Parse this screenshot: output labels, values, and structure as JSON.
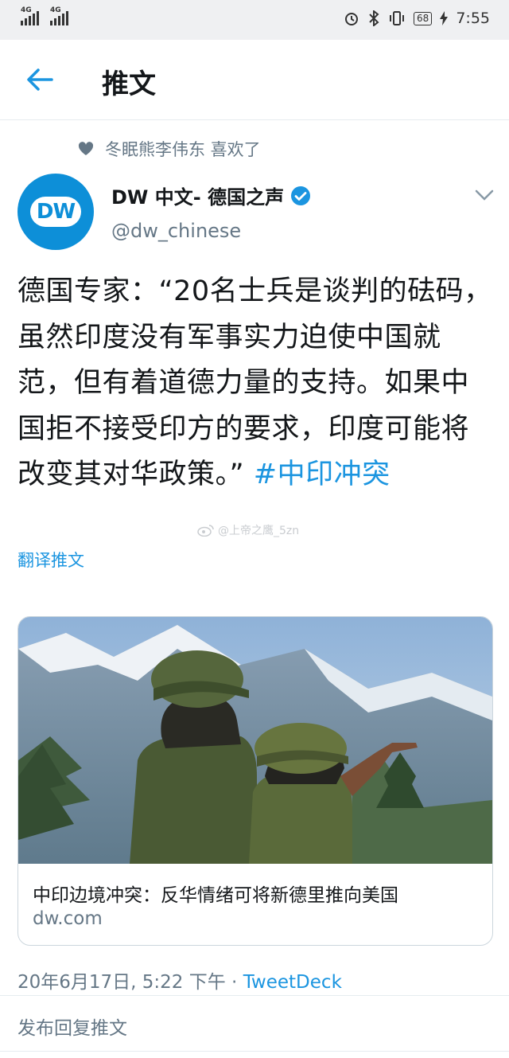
{
  "status_bar": {
    "signal1": "4G",
    "signal2": "4G",
    "battery": "68",
    "time": "7:55",
    "icons": [
      "alarm-icon",
      "bluetooth-icon",
      "vibrate-icon",
      "battery-icon",
      "charging-icon"
    ]
  },
  "header": {
    "back_icon": "arrow-left-icon",
    "title": "推文"
  },
  "liked_by": {
    "icon": "heart-icon",
    "text": "冬眠熊李伟东 喜欢了"
  },
  "tweet": {
    "avatar_text": "DW",
    "display_name": "DW 中文- 德国之声",
    "verified": true,
    "handle": "@dw_chinese",
    "text": "德国专家：“20名士兵是谈判的砝码，虽然印度没有军事实力迫使中国就范，但有着道德力量的支持。如果中国拒不接受印方的要求，印度可能将改变其对华政策。” ",
    "hashtag": "#中印冲突",
    "watermark": "@上帝之鹰_5zn",
    "translate_label": "翻译推文",
    "card": {
      "title": "中印边境冲突：反华情绪可将新德里推向美国",
      "domain": "dw.com"
    },
    "timestamp": "20年6月17日, 5:22 下午 · ",
    "source": "TweetDeck"
  },
  "reply_placeholder": "发布回复推文",
  "colors": {
    "accent": "#1b95e0",
    "secondary_text": "#657786",
    "dw_blue": "#0d8fd8"
  }
}
